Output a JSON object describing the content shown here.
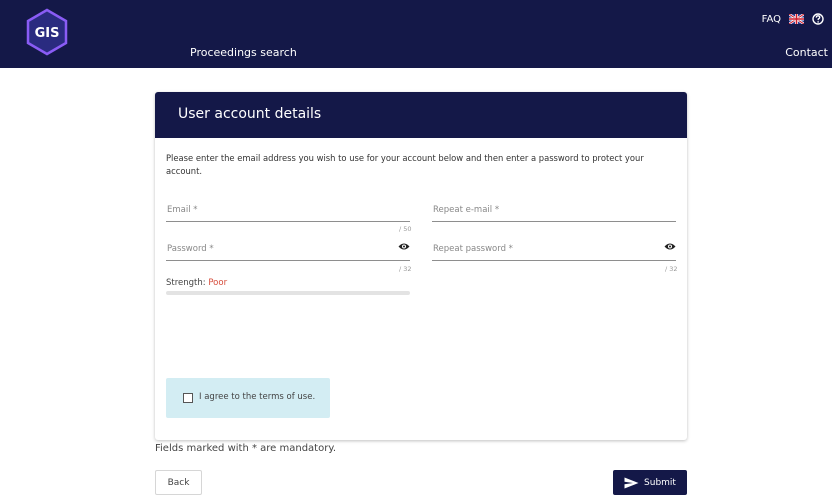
{
  "header": {
    "logo_text": "GIS",
    "nav_link": "Proceedings search",
    "faq": "FAQ",
    "contact": "Contact"
  },
  "card": {
    "title": "User account details",
    "intro": "Please enter the email address you wish to use for your account below and then enter a password to protect your account."
  },
  "fields": {
    "email": {
      "label": "Email *",
      "counter": "/ 50"
    },
    "repeat_email": {
      "label": "Repeat e-mail *"
    },
    "password": {
      "label": "Password *",
      "counter": "/ 32"
    },
    "repeat_password": {
      "label": "Repeat password *",
      "counter": "/ 32"
    }
  },
  "strength": {
    "label": "Strength:",
    "value": "Poor"
  },
  "terms": {
    "prefix": "I agree to the ",
    "link": "terms of use",
    "suffix": "."
  },
  "footer": {
    "mandatory_note": "Fields marked with * are mandatory.",
    "back_label": "Back",
    "submit_label": "Submit"
  },
  "colors": {
    "navy": "#141848",
    "terms_bg": "#d3edf3",
    "poor": "#d64b3a"
  },
  "icons": {
    "logo": "gis-hexagon-logo",
    "language": "uk-flag-icon",
    "help": "help-circle-icon",
    "password_toggle": "eye-icon",
    "submit": "send-icon"
  }
}
